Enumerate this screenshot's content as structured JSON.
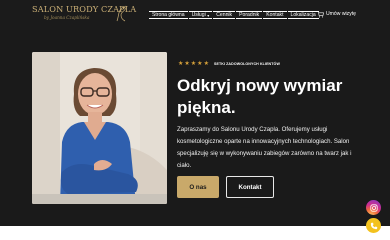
{
  "logo": {
    "main": "SALON URODY CZAPLA",
    "sub": "by Joanna Czaplińska"
  },
  "nav": {
    "items": [
      {
        "label": "Strona główna"
      },
      {
        "label": "Usługi",
        "has_dropdown": true
      },
      {
        "label": "Cennik"
      },
      {
        "label": "Poradnik"
      },
      {
        "label": "Kontakt"
      },
      {
        "label": "Lokalizacja"
      }
    ],
    "cta_label": "Umów wizytę"
  },
  "rating": {
    "stars": 5,
    "label": "SETKI ZADOWOLONYCH KLIENTÓW"
  },
  "hero": {
    "headline_line1": "Odkryj nowy wymiar",
    "headline_line2": "piękna.",
    "intro": "Zapraszamy do Salonu Urody Czapla. Oferujemy usługi kosmetologiczne oparte na innowacyjnych technologiach. Salon specjalizuję się w wykonywaniu zabiegów zarówno na twarz jak i ciało.",
    "primary_button": "O nas",
    "secondary_button": "Kontakt"
  },
  "colors": {
    "background": "#1a1a1a",
    "accent_gold": "#c9a96a",
    "star": "#d6a13a",
    "phone_button": "#f3c21e"
  },
  "floating": {
    "instagram_icon": "instagram-icon",
    "phone_icon": "phone-icon"
  }
}
